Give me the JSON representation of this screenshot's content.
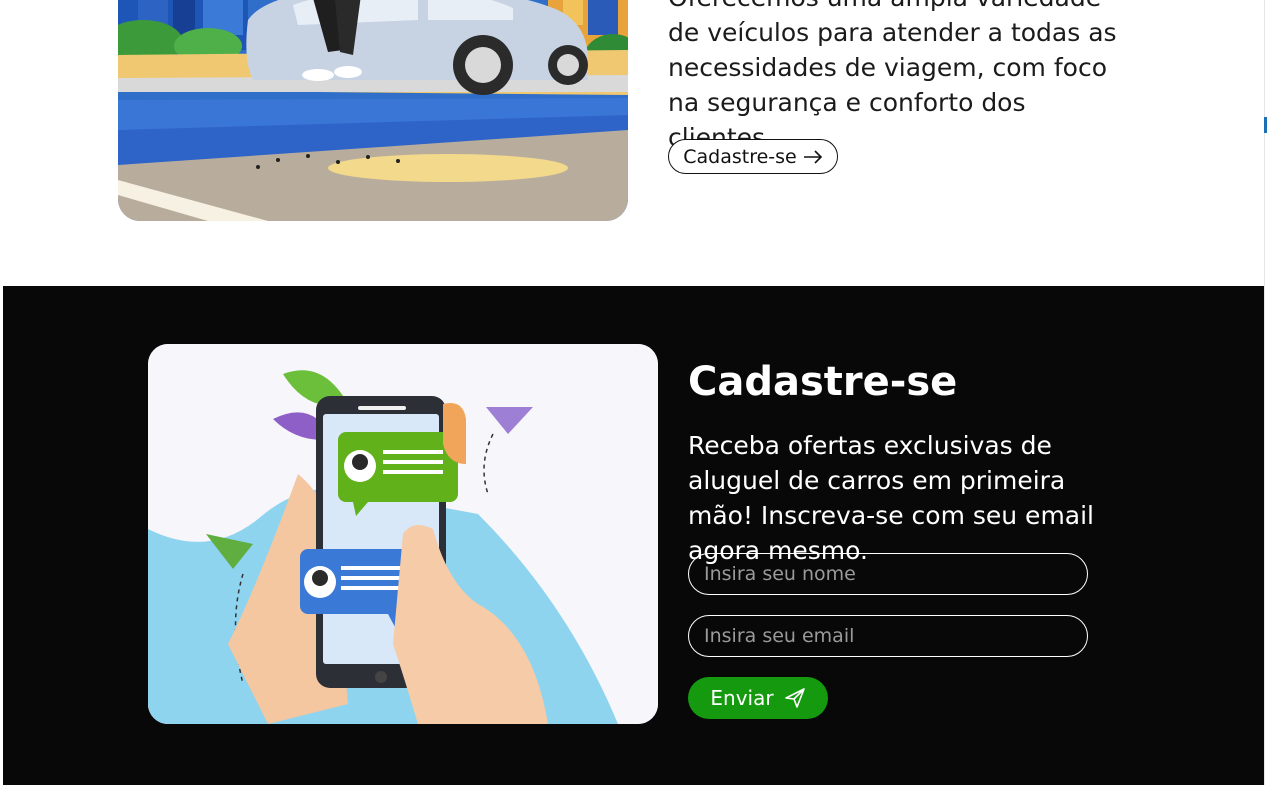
{
  "about": {
    "text": "Oferecemos uma ampla variedade de veículos para atender a todas as necessidades de viagem, com foco na segurança e conforto dos clientes.",
    "signup_button_label": "Cadastre-se",
    "signup_button_icon": "arrow-right-icon"
  },
  "newsletter": {
    "title": "Cadastre-se",
    "description": "Receba ofertas exclusivas de aluguel de carros em primeira mão! Inscreva-se com seu email agora mesmo.",
    "name_placeholder": "Insira seu nome",
    "email_placeholder": "Insira seu email",
    "send_button_label": "Enviar",
    "send_button_icon": "paper-plane-icon"
  },
  "colors": {
    "dark_section_background": "#080808",
    "send_button": "#159a0f"
  }
}
